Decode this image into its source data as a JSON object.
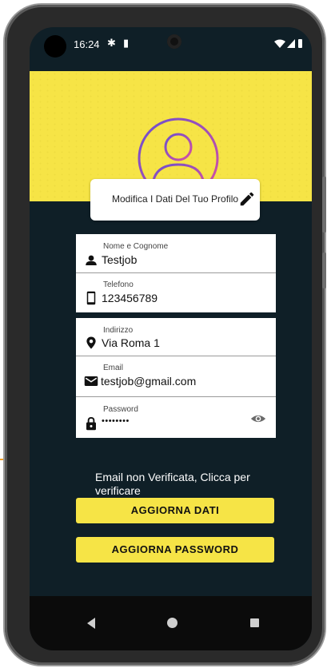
{
  "status_bar": {
    "time": "16:24"
  },
  "profile": {
    "edit_label": "Modifica I Dati Del Tuo Profilo"
  },
  "fields": {
    "name": {
      "label": "Nome e Cognome",
      "value": "Testjob"
    },
    "phone": {
      "label": "Telefono",
      "value": "123456789"
    },
    "address": {
      "label": "Indirizzo",
      "value": "Via Roma 1"
    },
    "email": {
      "label": "Email",
      "value": "testjob@gmail.com"
    },
    "password": {
      "label": "Password",
      "value": "••••••••"
    }
  },
  "notice": "Email non Verificata, Clicca per verificare",
  "buttons": {
    "update_data": "AGGIORNA DATI",
    "update_password": "AGGIORNA PASSWORD"
  },
  "colors": {
    "accent": "#f6e446",
    "background": "#0f1f27",
    "arrow": "#f2a12a"
  }
}
